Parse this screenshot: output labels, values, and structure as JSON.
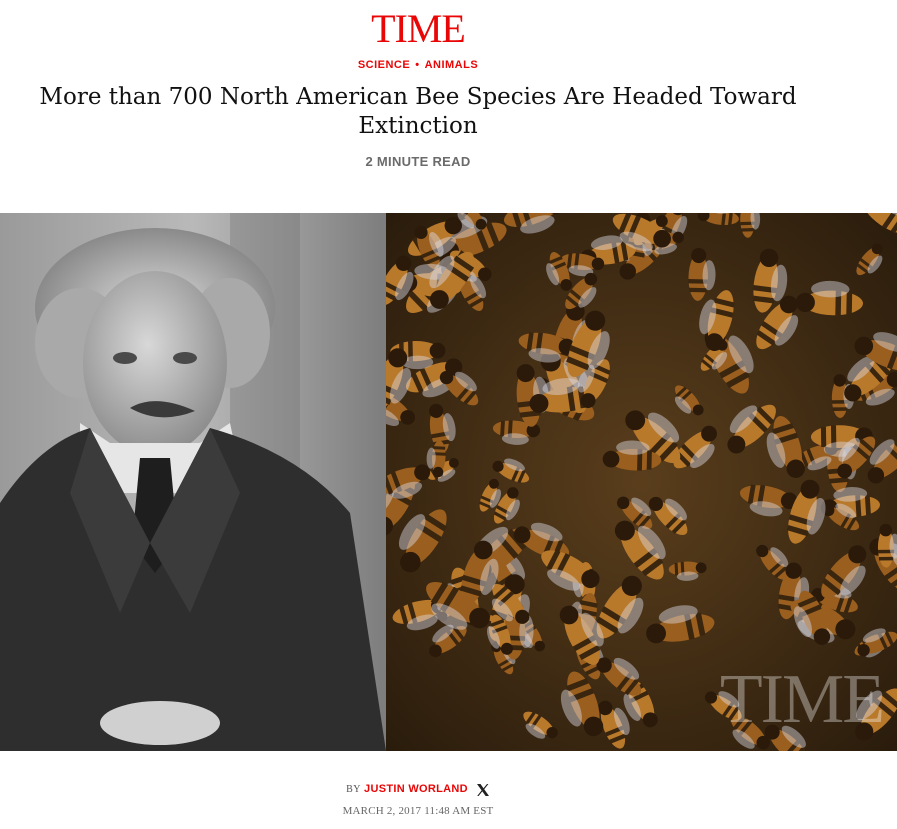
{
  "brand": {
    "logo_text": "TIME",
    "accent_color": "#e90606"
  },
  "article": {
    "sections": [
      "SCIENCE",
      "ANIMALS"
    ],
    "section_separator": "•",
    "headline": "More than 700 North American Bee Species Are Headed Toward Extinction",
    "read_time": "2 MINUTE READ",
    "hero_image": {
      "watermark": "TIME",
      "left_image": "portrait-photo",
      "right_image": "honeybees-photo"
    },
    "byline_prefix": "BY",
    "author": "JUSTIN WORLAND",
    "author_social_icon": "x-icon",
    "published": "MARCH 2, 2017 11:48 AM EST"
  }
}
